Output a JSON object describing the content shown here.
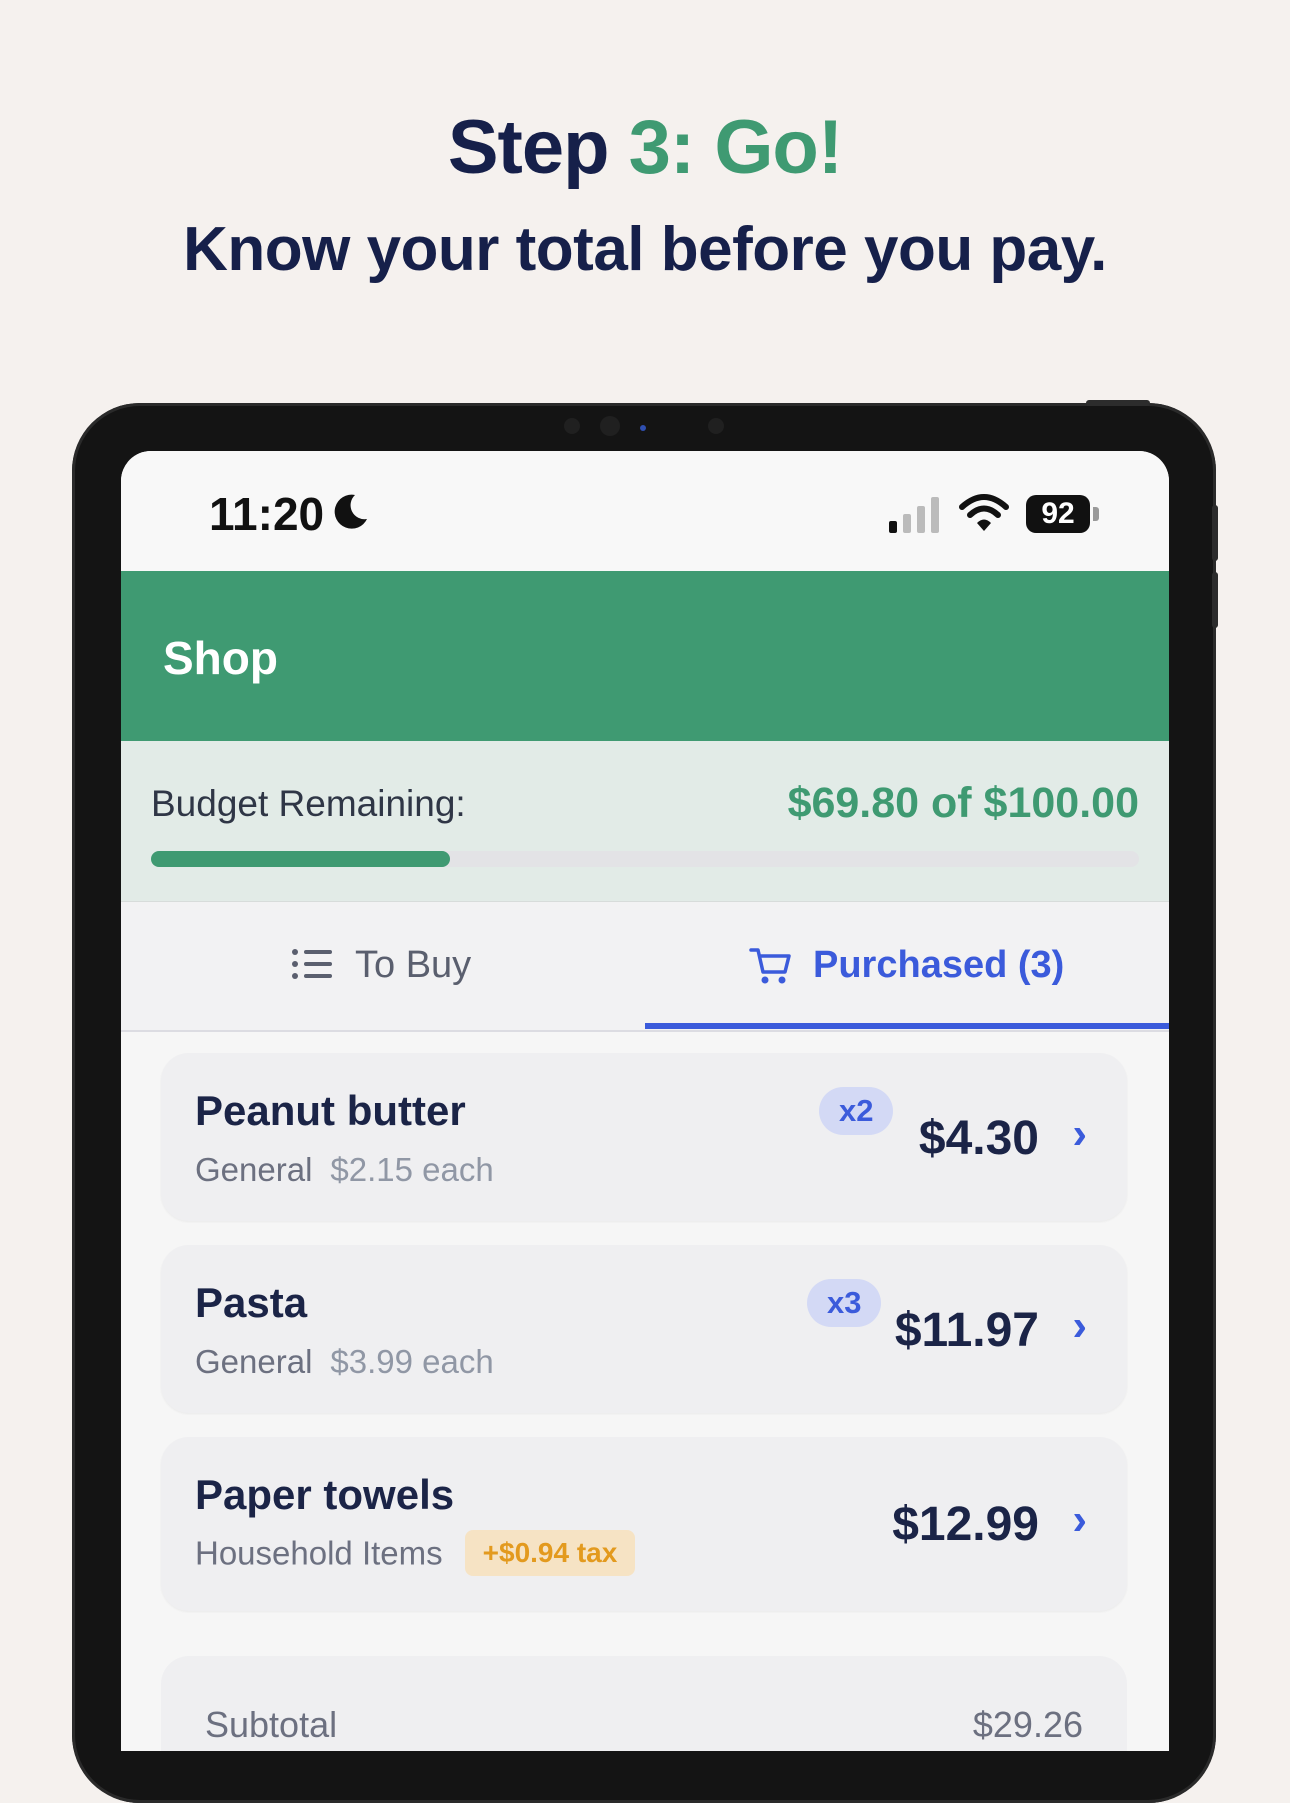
{
  "headline": {
    "prefix": "Step ",
    "accent": "3: Go!"
  },
  "subline": "Know your total before you pay.",
  "status_bar": {
    "time": "11:20",
    "battery": "92",
    "icons": [
      "moon-icon",
      "cellular-signal-icon",
      "wifi-icon",
      "battery-icon"
    ]
  },
  "app": {
    "title": "Shop"
  },
  "budget": {
    "label": "Budget Remaining:",
    "amount": "$69.80 of $100.00",
    "remaining_fraction": 0.303,
    "accent_color": "#3f9a72"
  },
  "tabs": [
    {
      "label": "To Buy",
      "icon": "list-icon",
      "active": false
    },
    {
      "label": "Purchased (3)",
      "icon": "cart-icon",
      "active": true
    }
  ],
  "items": [
    {
      "name": "Peanut butter",
      "category": "General",
      "each": "$2.15 each",
      "qty": "x2",
      "price": "$4.30"
    },
    {
      "name": "Pasta",
      "category": "General",
      "each": "$3.99 each",
      "qty": "x3",
      "price": "$11.97"
    },
    {
      "name": "Paper towels",
      "category": "Household Items",
      "tax": "+$0.94 tax",
      "price": "$12.99"
    }
  ],
  "subtotal": {
    "label": "Subtotal",
    "value": "$29.26"
  },
  "colors": {
    "primary": "#3f9a72",
    "tab_active": "#3b5bdb",
    "text_dark": "#1b2447",
    "tax_badge": "#e39a1e"
  }
}
